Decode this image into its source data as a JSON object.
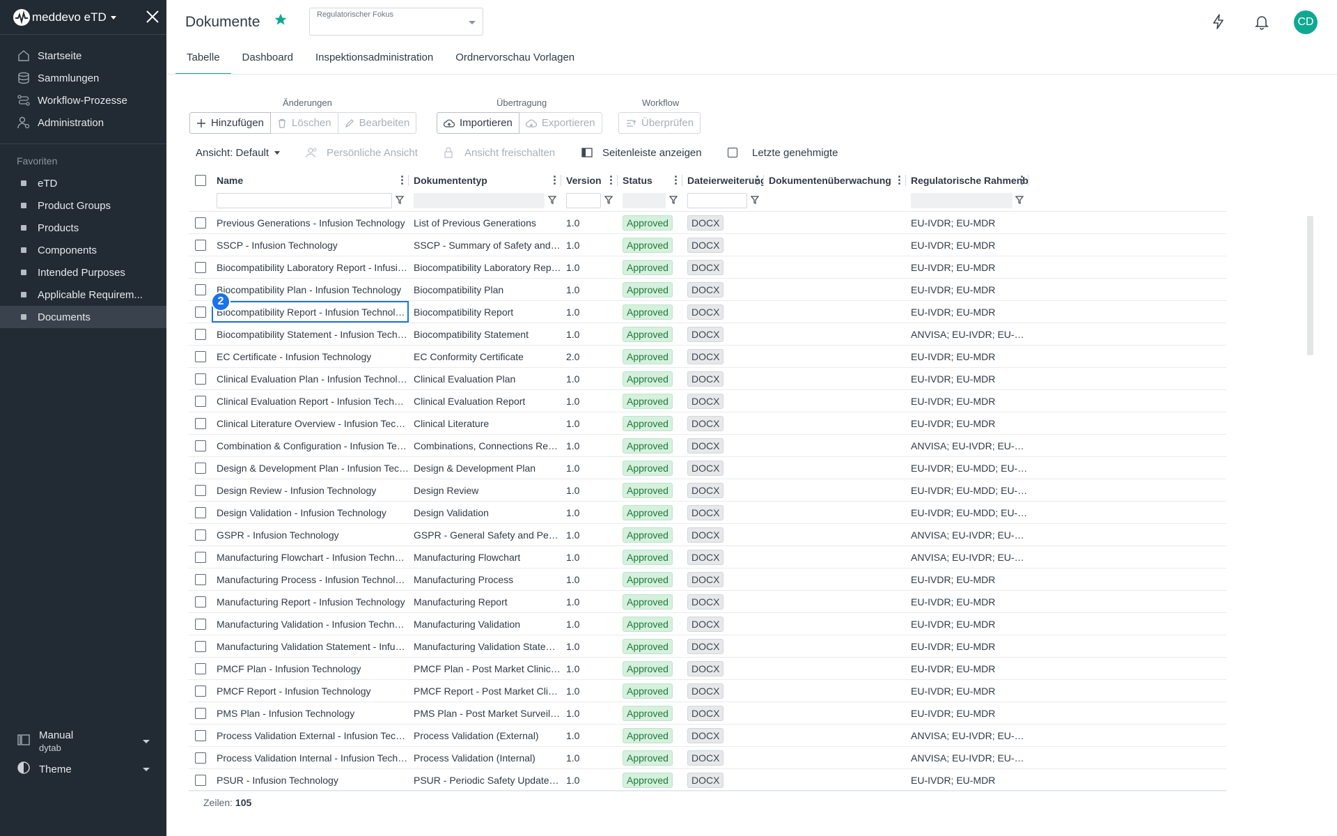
{
  "sidebar": {
    "app_name": "meddevo eTD",
    "nav": [
      {
        "label": "Startseite",
        "icon": "home-icon"
      },
      {
        "label": "Sammlungen",
        "icon": "database-icon"
      },
      {
        "label": "Workflow-Prozesse",
        "icon": "workflow-icon"
      },
      {
        "label": "Administration",
        "icon": "admin-user-icon"
      }
    ],
    "favorites_title": "Favoriten",
    "favorites": [
      "eTD",
      "Product Groups",
      "Products",
      "Components",
      "Intended Purposes",
      "Applicable Requirem...",
      "Documents"
    ],
    "active_favorite": "Documents",
    "workspace": {
      "title": "Manual",
      "subtitle": "dytab"
    },
    "theme_label": "Theme"
  },
  "header": {
    "title": "Dokumente",
    "reg_focus_label": "Regulatorischer Fokus",
    "avatar_initials": "CD",
    "accent": "#0fa892"
  },
  "tabs": [
    "Tabelle",
    "Dashboard",
    "Inspektionsadministration",
    "Ordnervorschau Vorlagen"
  ],
  "active_tab": "Tabelle",
  "toolbar": {
    "groups": {
      "changes": "Änderungen",
      "transfer": "Übertragung",
      "workflow": "Workflow"
    },
    "add": "Hinzufügen",
    "delete": "Löschen",
    "edit": "Bearbeiten",
    "import": "Importieren",
    "export": "Exportieren",
    "review": "Überprüfen"
  },
  "options": {
    "view": "Ansicht: Default",
    "personal_view": "Persönliche Ansicht",
    "unlock_view": "Ansicht freischalten",
    "show_sidebar": "Seitenleiste anzeigen",
    "last_approved": "Letzte genehmigte"
  },
  "columns": [
    "Name",
    "Dokumententyp",
    "Version",
    "Status",
    "Dateierweiterung",
    "Dokumentenüberwachung",
    "Regulatorische Rahmenbe..."
  ],
  "rows": [
    [
      "Previous Generations - Infusion Technology",
      "List of Previous Generations",
      "1.0",
      "Approved",
      "DOCX",
      "",
      "EU-IVDR; EU-MDR"
    ],
    [
      "SSCP - Infusion Technology",
      "SSCP - Summary of Safety and Clinical...",
      "1.0",
      "Approved",
      "DOCX",
      "",
      "EU-IVDR; EU-MDR"
    ],
    [
      "Biocompatibility Laboratory Report - Infusion Techn...",
      "Biocompatibility Laboratory Report",
      "1.0",
      "Approved",
      "DOCX",
      "",
      "EU-IVDR; EU-MDR"
    ],
    [
      "Biocompatibility Plan - Infusion Technology",
      "Biocompatibility Plan",
      "1.0",
      "Approved",
      "DOCX",
      "",
      "EU-IVDR; EU-MDR"
    ],
    [
      "Biocompatibility Report - Infusion Technology",
      "Biocompatibility Report",
      "1.0",
      "Approved",
      "DOCX",
      "",
      "EU-IVDR; EU-MDR"
    ],
    [
      "Biocompatibility Statement - Infusion Technology",
      "Biocompatibility Statement",
      "1.0",
      "Approved",
      "DOCX",
      "",
      "ANVISA; EU-IVDR; EU-MDD; EU..."
    ],
    [
      "EC Certificate - Infusion Technology",
      "EC Conformity Certificate",
      "2.0",
      "Approved",
      "DOCX",
      "",
      "EU-IVDR; EU-MDR"
    ],
    [
      "Clinical Evaluation Plan - Infusion Technology",
      "Clinical Evaluation Plan",
      "1.0",
      "Approved",
      "DOCX",
      "",
      "EU-IVDR; EU-MDR"
    ],
    [
      "Clinical Evaluation Report - Infusion Technology",
      "Clinical Evaluation Report",
      "1.0",
      "Approved",
      "DOCX",
      "",
      "EU-IVDR; EU-MDR"
    ],
    [
      "Clinical Literature Overview - Infusion Technology",
      "Clinical Literature",
      "1.0",
      "Approved",
      "DOCX",
      "",
      "EU-IVDR; EU-MDR"
    ],
    [
      "Combination & Configuration - Infusion Technology",
      "Combinations, Connections Report",
      "1.0",
      "Approved",
      "DOCX",
      "",
      "ANVISA; EU-IVDR; EU-MDD; EU..."
    ],
    [
      "Design & Development Plan - Infusion Technology",
      "Design & Development Plan",
      "1.0",
      "Approved",
      "DOCX",
      "",
      "EU-IVDR; EU-MDD; EU-MDR; US..."
    ],
    [
      "Design Review - Infusion Technology",
      "Design Review",
      "1.0",
      "Approved",
      "DOCX",
      "",
      "EU-IVDR; EU-MDD; EU-MDR; US..."
    ],
    [
      "Design Validation - Infusion Technology",
      "Design Validation",
      "1.0",
      "Approved",
      "DOCX",
      "",
      "EU-IVDR; EU-MDD; EU-MDR; US..."
    ],
    [
      "GSPR - Infusion Technology",
      "GSPR - General Safety and Performanc...",
      "1.0",
      "Approved",
      "DOCX",
      "",
      "ANVISA; EU-IVDR; EU-MDD; EU..."
    ],
    [
      "Manufacturing Flowchart - Infusion Technology",
      "Manufacturing Flowchart",
      "1.0",
      "Approved",
      "DOCX",
      "",
      "ANVISA; EU-IVDR; EU-MDD; EU..."
    ],
    [
      "Manufacturing Process - Infusion Technology",
      "Manufacturing Process",
      "1.0",
      "Approved",
      "DOCX",
      "",
      "EU-IVDR; EU-MDR"
    ],
    [
      "Manufacturing Report - Infusion Technology",
      "Manufacturing Report",
      "1.0",
      "Approved",
      "DOCX",
      "",
      "EU-IVDR; EU-MDR"
    ],
    [
      "Manufacturing Validation - Infusion Technology",
      "Manufacturing Validation",
      "1.0",
      "Approved",
      "DOCX",
      "",
      "EU-IVDR; EU-MDR"
    ],
    [
      "Manufacturing Validation Statement - Infusion Tech...",
      "Manufacturing Validation Statement",
      "1.0",
      "Approved",
      "DOCX",
      "",
      "EU-IVDR; EU-MDR"
    ],
    [
      "PMCF Plan - Infusion Technology",
      "PMCF Plan - Post Market Clinical Follo...",
      "1.0",
      "Approved",
      "DOCX",
      "",
      "EU-IVDR; EU-MDR"
    ],
    [
      "PMCF Report - Infusion Technology",
      "PMCF Report - Post Market Clinical Fol...",
      "1.0",
      "Approved",
      "DOCX",
      "",
      "EU-IVDR; EU-MDR"
    ],
    [
      "PMS Plan - Infusion Technology",
      "PMS Plan - Post Market Surveillance Pl...",
      "1.0",
      "Approved",
      "DOCX",
      "",
      "EU-IVDR; EU-MDR"
    ],
    [
      "Process Validation External - Infusion Technology",
      "Process Validation (External)",
      "1.0",
      "Approved",
      "DOCX",
      "",
      "ANVISA; EU-IVDR; EU-MDR; US..."
    ],
    [
      "Process Validation Internal - Infusion Technology",
      "Process Validation (Internal)",
      "1.0",
      "Approved",
      "DOCX",
      "",
      "ANVISA; EU-IVDR; EU-MDR; US..."
    ],
    [
      "PSUR - Infusion Technology",
      "PSUR - Periodic Safety Update Report",
      "1.0",
      "Approved",
      "DOCX",
      "",
      "EU-IVDR; EU-MDR"
    ]
  ],
  "selected_row_index": 4,
  "marker_label": "2",
  "footer": {
    "rows_label": "Zeilen:",
    "rows_count": "105"
  }
}
